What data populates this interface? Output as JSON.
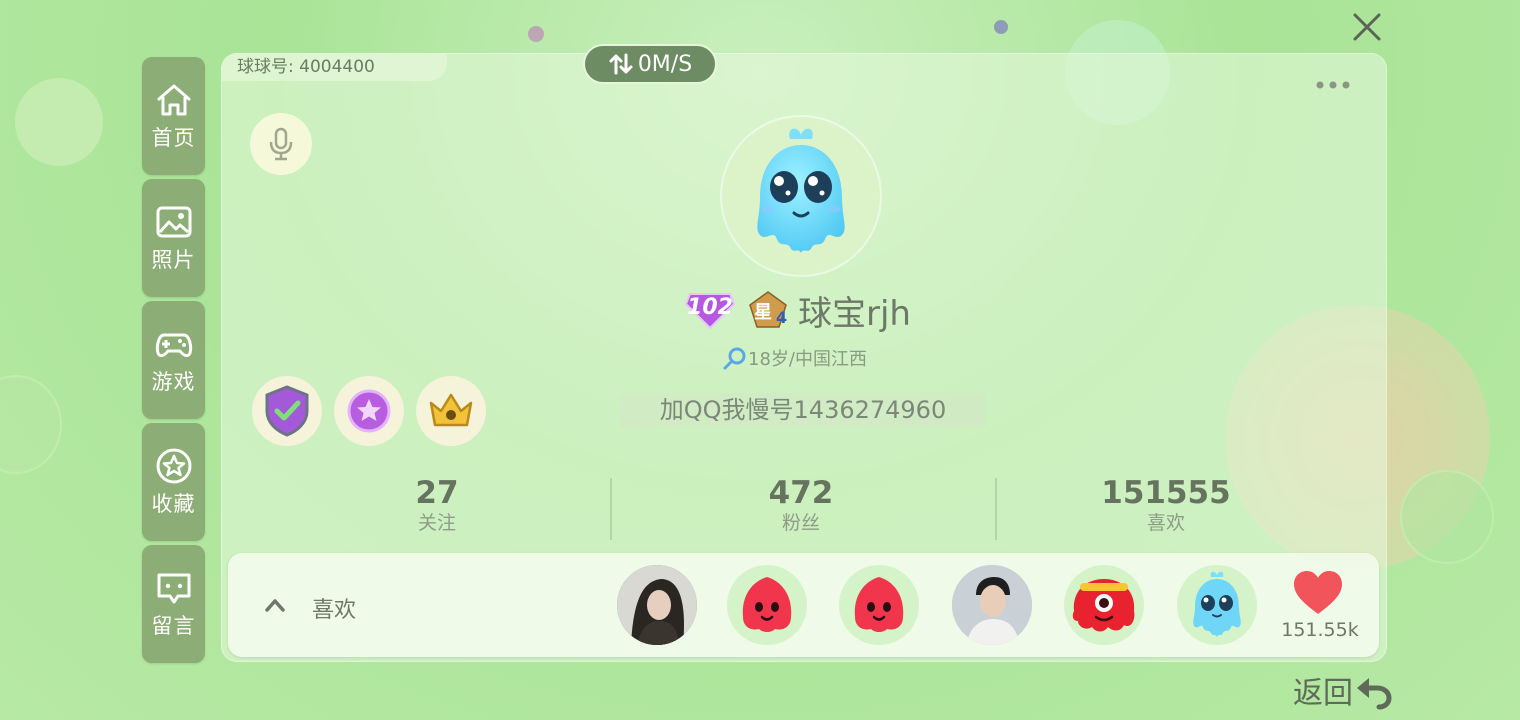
{
  "header": {
    "account_id": "球球号: 4004400",
    "network_speed": "0M/S"
  },
  "sidebar": {
    "items": [
      {
        "label": "首页",
        "icon": "home-icon"
      },
      {
        "label": "照片",
        "icon": "photo-icon"
      },
      {
        "label": "游戏",
        "icon": "gamepad-icon"
      },
      {
        "label": "收藏",
        "icon": "star-icon"
      },
      {
        "label": "留言",
        "icon": "message-icon"
      }
    ]
  },
  "profile": {
    "level": "102",
    "star_badge": "星",
    "star_level": "4",
    "username": "球宝rjh",
    "info": "18岁/中国江西",
    "signature": "加QQ我慢号1436274960"
  },
  "stats": [
    {
      "value": "27",
      "label": "关注"
    },
    {
      "value": "472",
      "label": "粉丝"
    },
    {
      "value": "151555",
      "label": "喜欢"
    }
  ],
  "likes": {
    "label": "喜欢",
    "heart_count": "151.55k"
  },
  "footer": {
    "back_label": "返回"
  },
  "colors": {
    "sidebar": "#8cad76",
    "accent_heart": "#f2545b",
    "background": "#a9e497"
  }
}
